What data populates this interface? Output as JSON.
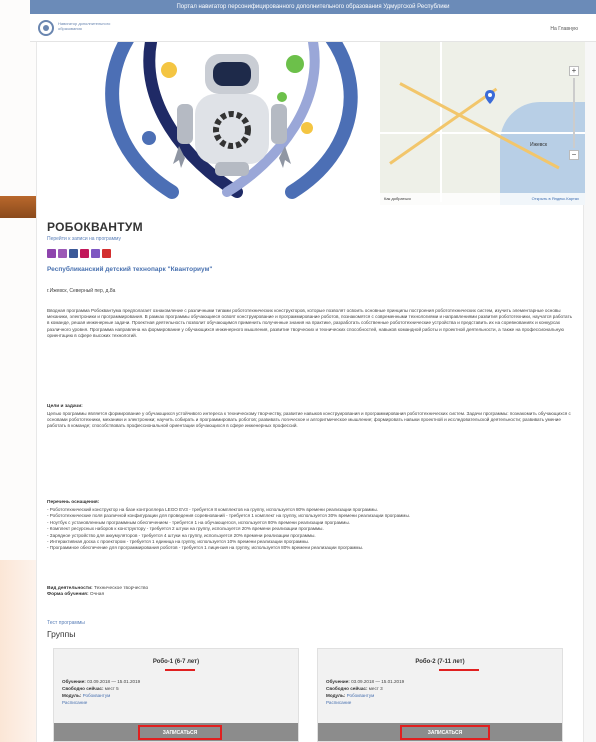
{
  "banner": {
    "text": "Портал навигатор персонифицированного дополнительного образования Удмуртской Республики"
  },
  "header": {
    "logo_text": "Навигатор дополнительного образования",
    "right_link": "На Главную"
  },
  "map": {
    "city_label": "Ижевск",
    "footer_left": "Как добраться",
    "footer_right": "Открыть в Яндекс.Картах"
  },
  "program": {
    "title": "РОБОКВАНТУМ",
    "share_link": "Перейти к записи на программу",
    "organization": "Республиканский детский технопарк \"Кванториум\"",
    "address": "г.Ижевск, Северный пер, д.8а",
    "description": "Вводная программа Робоквантума предполагает ознакомление с различными типами робототехнических конструкторов, которые позволят освоить основные принципы построения робототехнических систем, изучить элементарные основы механики, электроники и программирования. В рамках программы обучающиеся освоят конструирование и программирование роботов, познакомятся с современными технологиями и направлениями развития робототехники, научатся работать в команде, решая инженерные задачи. Проектная деятельность позволит обучающимся применить полученные знания на практике, разработать собственные робототехнические устройства и представить их на соревнованиях и конкурсах различного уровня. Программа направлена на формирование у обучающихся инженерного мышления, развитие творческих и технических способностей, навыков командной работы и проектной деятельности, а также на профессиональную ориентацию в сфере высоких технологий.",
    "goals_title": "Цели и задачи:",
    "goals": "Целью программы является формирование у обучающихся устойчивого интереса к техническому творчеству, развитие навыков конструирования и программирования робототехнических систем. Задачи программы: познакомить обучающихся с основами робототехники, механики и электроники; научить собирать и программировать роботов; развивать логическое и алгоритмическое мышление; формировать навыки проектной и исследовательской деятельности; развивать умение работать в команде; способствовать профессиональной ориентации обучающихся в сфере инженерных профессий.",
    "requirements_title": "Перечень оснащения:",
    "requirements": [
      "- Робототехнический конструктор на базе контроллера LEGO EV3 - требуется 8 комплектов на группу, используется 80% времени реализации программы.",
      "- Робототехнические поля различной конфигурации для проведения соревнований - требуется 1 комплект на группу, используется 30% времени реализации программы.",
      "- Ноутбук с установленным программным обеспечением - требуется 1 на обучающегося, используется 80% времени реализации программы.",
      "- Комплект ресурсных наборов к конструктору - требуется 2 штуки на группу, используется 20% времени реализации программы.",
      "- Зарядное устройство для аккумуляторов - требуется 4 штуки на группу, используется 20% времени реализации программы.",
      "- Интерактивная доска с проектором - требуется 1 единица на группу, используется 10% времени реализации программы.",
      "- Программное обеспечение для программирования роботов - требуется 1 лицензия на группу, используется 80% времени реализации программы."
    ],
    "activity_label": "Вид деятельности:",
    "activity_value": "Техническое творчество",
    "form_label": "Форма обучения:",
    "form_value": "Очная",
    "more_link": "Тест программы"
  },
  "groups": {
    "title": "Группы",
    "items": [
      {
        "name": "Робо-1",
        "age": "(6-7 лет)",
        "period_label": "Обучение:",
        "period_value": "03.09.2018 — 15.01.2019",
        "seats_label": "Свободно сейчас:",
        "seats_value": "мест 5",
        "module_label": "Модуль:",
        "module_value": "Робоквантум",
        "schedule_link": "Расписание",
        "button": "ЗАПИСАТЬСЯ"
      },
      {
        "name": "Робо-2",
        "age": "(7-11 лет)",
        "period_label": "Обучение:",
        "period_value": "03.09.2018 — 15.01.2019",
        "seats_label": "Свободно сейчас:",
        "seats_value": "мест 3",
        "module_label": "Модуль:",
        "module_value": "Робоквантум",
        "schedule_link": "Расписание",
        "button": "ЗАПИСАТЬСЯ"
      }
    ]
  },
  "colors": {
    "banner": "#6b8bb8",
    "accent_link": "#4a72b0",
    "highlight": "#e02020",
    "button_bg": "#8c8c8c",
    "social": [
      "#8e44ad",
      "#9b59b6",
      "#3b5998",
      "#c2185b",
      "#7e57c2",
      "#d32f2f"
    ]
  },
  "icons": [
    "logo-icon",
    "map-pin-icon",
    "social-icons"
  ]
}
